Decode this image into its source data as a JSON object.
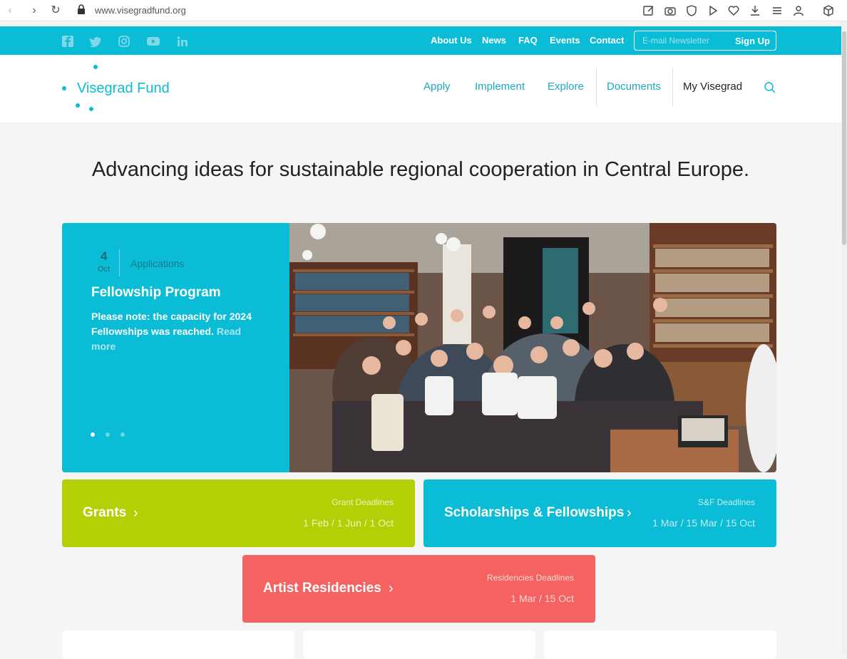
{
  "browser": {
    "url": "www.visegradfund.org"
  },
  "topbar": {
    "links": [
      "About Us",
      "News",
      "FAQ",
      "Events",
      "Contact"
    ],
    "newsletter_placeholder": "E-mail Newsletter",
    "signup_label": "Sign Up"
  },
  "header": {
    "logo_text": "Visegrad Fund",
    "menu": [
      "Apply",
      "Implement",
      "Explore",
      "Documents",
      "My Visegrad"
    ]
  },
  "tagline": "Advancing ideas for sustainable regional cooperation in Central Europe.",
  "hero": {
    "date_day": "4",
    "date_month": "Oct",
    "category": "Applications",
    "title": "Fellowship Program",
    "text": "Please note: the capacity for 2024 Fellowships was reached.",
    "read_more": "Read more",
    "slides_count": 3,
    "active_slide": 1
  },
  "cards": [
    {
      "title": "Grants",
      "deadline_label": "Grant Deadlines",
      "deadlines": "1 Feb / 1 Jun / 1 Oct",
      "color": "#b5cf06"
    },
    {
      "title": "Scholarships & Fellowships",
      "deadline_label": "S&F Deadlines",
      "deadlines": "1 Mar / 15 Mar / 15 Oct",
      "color": "#0bbcd6"
    },
    {
      "title": "Artist Residencies",
      "deadline_label": "Residencies Deadlines",
      "deadlines": "1 Mar / 15 Oct",
      "color": "#f46262"
    }
  ],
  "colors": {
    "brand": "#0bbcd6",
    "grants": "#b5cf06",
    "residencies": "#f46262"
  }
}
